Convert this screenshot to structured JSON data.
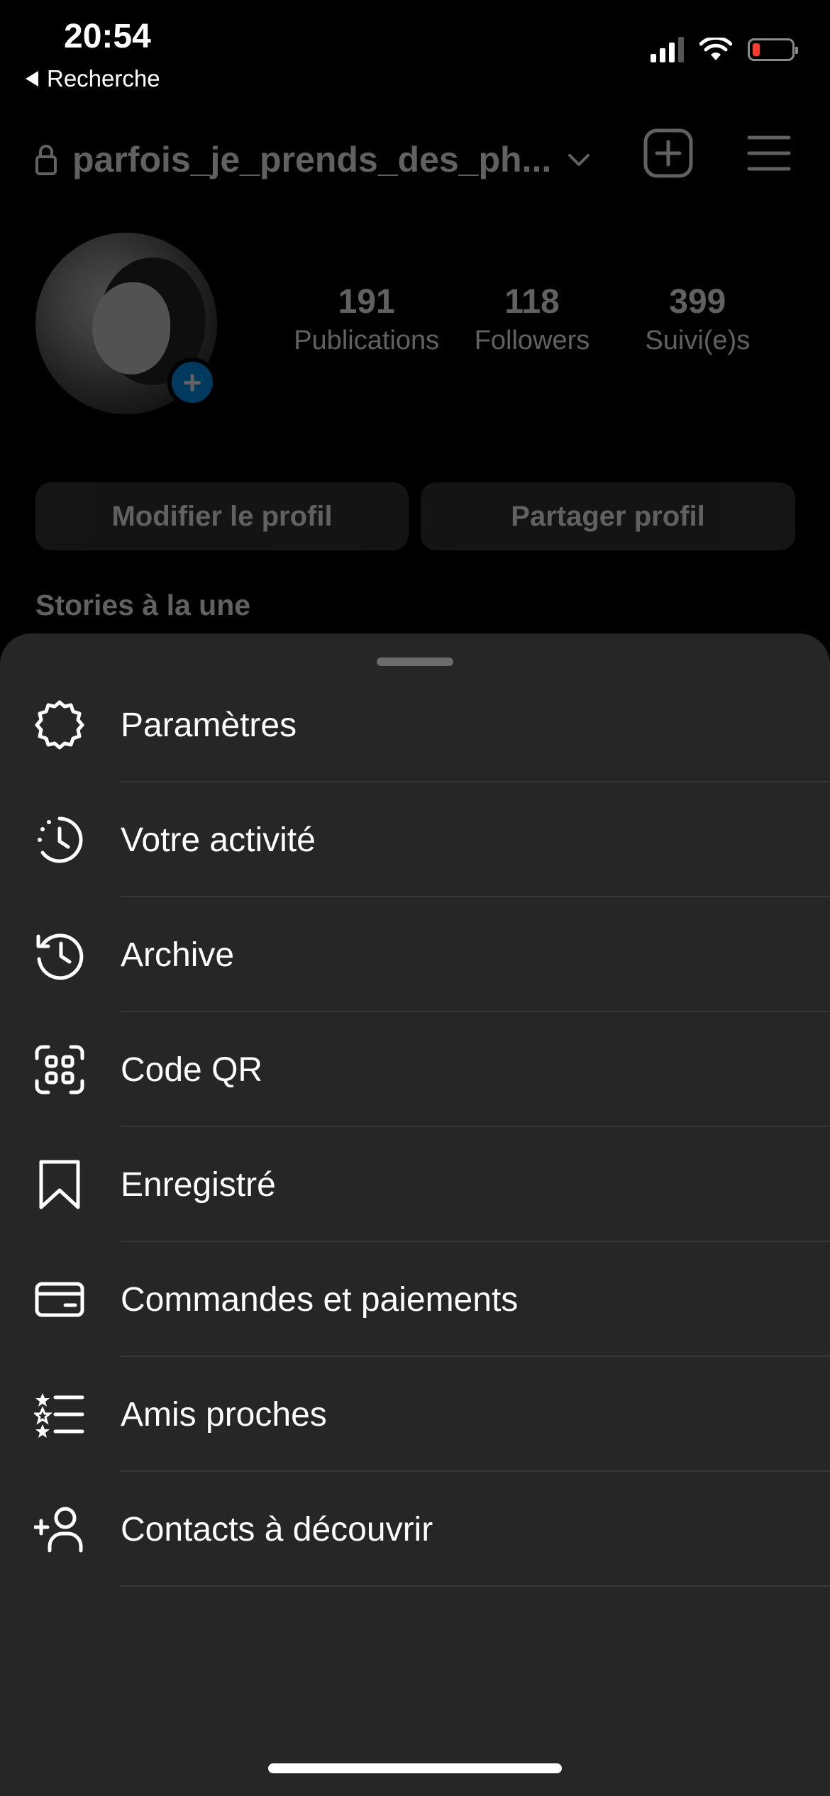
{
  "status_bar": {
    "time": "20:54",
    "back_label": "Recherche"
  },
  "profile": {
    "username": "parfois_je_prends_des_ph...",
    "stats": [
      {
        "value": "191",
        "label": "Publications"
      },
      {
        "value": "118",
        "label": "Followers"
      },
      {
        "value": "399",
        "label": "Suivi(e)s"
      }
    ],
    "edit_button": "Modifier le profil",
    "share_button": "Partager profil",
    "highlights_title": "Stories à la une"
  },
  "menu": {
    "items": [
      {
        "label": "Paramètres",
        "icon": "settings-icon"
      },
      {
        "label": "Votre activité",
        "icon": "activity-icon"
      },
      {
        "label": "Archive",
        "icon": "archive-icon"
      },
      {
        "label": "Code QR",
        "icon": "qr-code-icon"
      },
      {
        "label": "Enregistré",
        "icon": "bookmark-icon"
      },
      {
        "label": "Commandes et paiements",
        "icon": "card-icon"
      },
      {
        "label": "Amis proches",
        "icon": "close-friends-icon"
      },
      {
        "label": "Contacts à découvrir",
        "icon": "add-person-icon"
      }
    ]
  },
  "colors": {
    "background": "#000000",
    "sheet": "#262626",
    "accent": "#0095f6",
    "battery_low": "#ff3b30"
  }
}
